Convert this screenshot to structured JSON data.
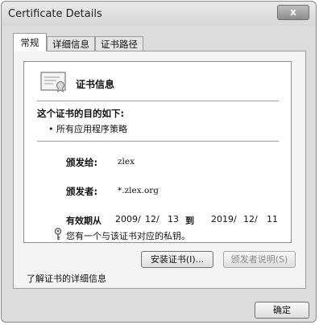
{
  "window": {
    "title": "Certificate Details",
    "close_label": "x"
  },
  "tabs": [
    {
      "label": "常规",
      "active": true
    },
    {
      "label": "详细信息",
      "active": false
    },
    {
      "label": "证书路径",
      "active": false
    }
  ],
  "cert_info": {
    "title": "证书信息",
    "purpose_heading": "这个证书的目的如下:",
    "purpose_item": "• 所有应用程序策略",
    "issued_to_label": "颁发给:",
    "issued_to_value": "zlex",
    "issued_by_label": "颁发者:",
    "issued_by_value": "*.zlex.org",
    "valid_label": "有效期从",
    "valid_from_year": "2009/",
    "valid_from_month": "12/",
    "valid_from_day": "13",
    "valid_to_label": "到",
    "valid_to_year": "2019/",
    "valid_to_month": "12/",
    "valid_to_day": "11",
    "private_key_note": "您有一个与该证书对应的私钥。"
  },
  "buttons": {
    "install_label": "安装证书(I)...",
    "issuer_statement_label": "颁发者说明(S)",
    "ok_label": "确定"
  },
  "links": {
    "learn_more_label": "了解证书的详细信息"
  },
  "icons": {
    "certificate": "certificate-icon",
    "key": "key-icon",
    "close": "close-icon"
  }
}
